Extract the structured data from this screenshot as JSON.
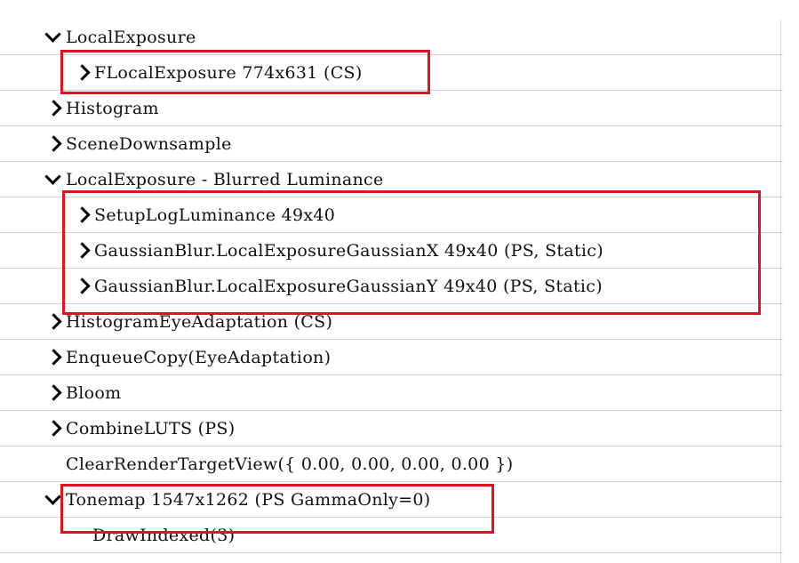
{
  "tree": {
    "items": [
      {
        "label": "LocalExposure",
        "expanded": true
      },
      {
        "label": "FLocalExposure 774x631 (CS)",
        "expanded": false
      },
      {
        "label": "Histogram",
        "expanded": false
      },
      {
        "label": "SceneDownsample",
        "expanded": false
      },
      {
        "label": "LocalExposure - Blurred Luminance",
        "expanded": true
      },
      {
        "label": "SetupLogLuminance 49x40",
        "expanded": false
      },
      {
        "label": "GaussianBlur.LocalExposureGaussianX 49x40 (PS, Static)",
        "expanded": false
      },
      {
        "label": "GaussianBlur.LocalExposureGaussianY 49x40 (PS, Static)",
        "expanded": false
      },
      {
        "label": "HistogramEyeAdaptation (CS)",
        "expanded": false
      },
      {
        "label": "EnqueueCopy(EyeAdaptation)",
        "expanded": false
      },
      {
        "label": "Bloom",
        "expanded": false
      },
      {
        "label": "CombineLUTS (PS)",
        "expanded": false
      },
      {
        "label": "ClearRenderTargetView({ 0.00, 0.00, 0.00, 0.00 })",
        "expanded": null
      },
      {
        "label": "Tonemap 1547x1262 (PS GammaOnly=0)",
        "expanded": true
      },
      {
        "label": "DrawIndexed(3)",
        "expanded": null
      }
    ]
  },
  "colors": {
    "highlight": "#e0141e",
    "grid": "#d4d4d4"
  }
}
